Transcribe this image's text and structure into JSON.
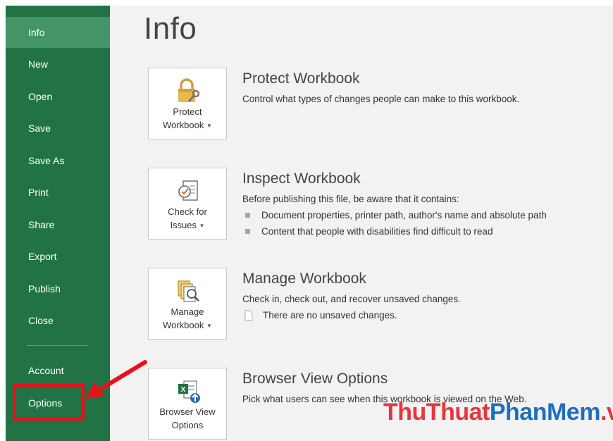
{
  "nav": {
    "items": [
      {
        "label": "Info",
        "active": true
      },
      {
        "label": "New"
      },
      {
        "label": "Open"
      },
      {
        "label": "Save"
      },
      {
        "label": "Save As"
      },
      {
        "label": "Print"
      },
      {
        "label": "Share"
      },
      {
        "label": "Export"
      },
      {
        "label": "Publish"
      },
      {
        "label": "Close"
      }
    ],
    "account": "Account",
    "options": "Options"
  },
  "page_title": "Info",
  "sections": [
    {
      "tile_line1": "Protect",
      "tile_line2": "Workbook",
      "title": "Protect Workbook",
      "desc": "Control what types of changes people can make to this workbook."
    },
    {
      "tile_line1": "Check for",
      "tile_line2": "Issues",
      "title": "Inspect Workbook",
      "desc": "Before publishing this file, be aware that it contains:",
      "bullets": [
        "Document properties, printer path, author's name and absolute path",
        "Content that people with disabilities find difficult to read"
      ]
    },
    {
      "tile_line1": "Manage",
      "tile_line2": "Workbook",
      "title": "Manage Workbook",
      "desc": "Check in, check out, and recover unsaved changes.",
      "note": "There are no unsaved changes."
    },
    {
      "tile_line1": "Browser View",
      "tile_line2": "Options",
      "title": "Browser View Options",
      "desc": "Pick what users can see when this workbook is viewed on the Web."
    }
  ],
  "watermark": {
    "part1": "ThuThuat",
    "part2": "PhanMem",
    "part3": ".vn"
  },
  "colors": {
    "sidebar": "#217346",
    "active": "#439467",
    "highlight": "#e8111a"
  }
}
